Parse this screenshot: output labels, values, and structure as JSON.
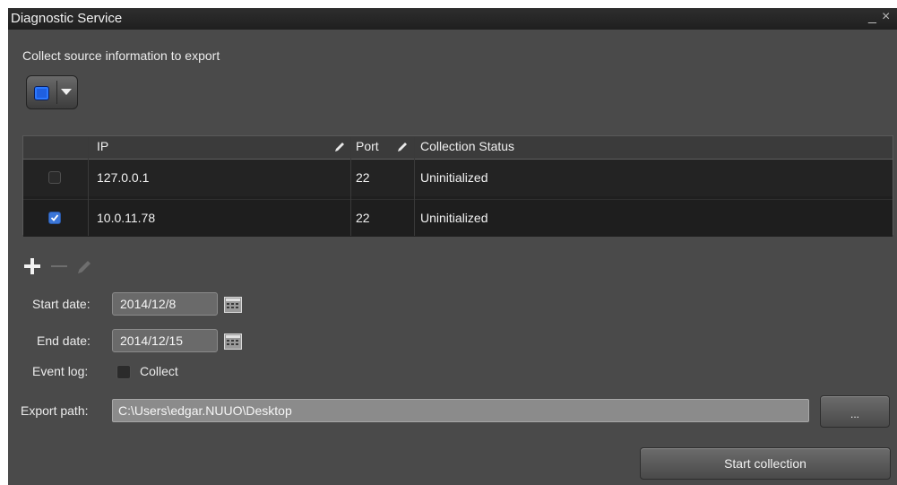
{
  "window": {
    "title": "Diagnostic Service",
    "minimize_symbol": "_",
    "close_symbol": "×"
  },
  "sources": {
    "label": "Collect source information to export",
    "selector_icon": "source-selector-icon"
  },
  "table": {
    "headers": {
      "ip": "IP",
      "port": "Port",
      "status": "Collection Status"
    },
    "rows": [
      {
        "checked": false,
        "ip": "127.0.0.1",
        "port": "22",
        "status": "Uninitialized"
      },
      {
        "checked": true,
        "ip": "10.0.11.78",
        "port": "22",
        "status": "Uninitialized"
      }
    ]
  },
  "toolbar": {
    "add_icon": "plus-icon",
    "remove_icon": "minus-icon",
    "edit_icon": "pencil-icon"
  },
  "form": {
    "start_date_label": "Start date:",
    "start_date": "2014/12/8",
    "end_date_label": "End date:",
    "end_date": "2014/12/15",
    "event_log_label": "Event log:",
    "event_log_option": "Collect",
    "event_log_checked": false,
    "export_path_label": "Export path:",
    "export_path": "C:\\Users\\edgar.NUUO\\Desktop",
    "browse_label": "...",
    "start_label": "Start collection"
  },
  "colors": {
    "window_bg": "#4a4a4a",
    "accent_blue": "#3b76d8",
    "table_bg": "#1f1f1f"
  }
}
